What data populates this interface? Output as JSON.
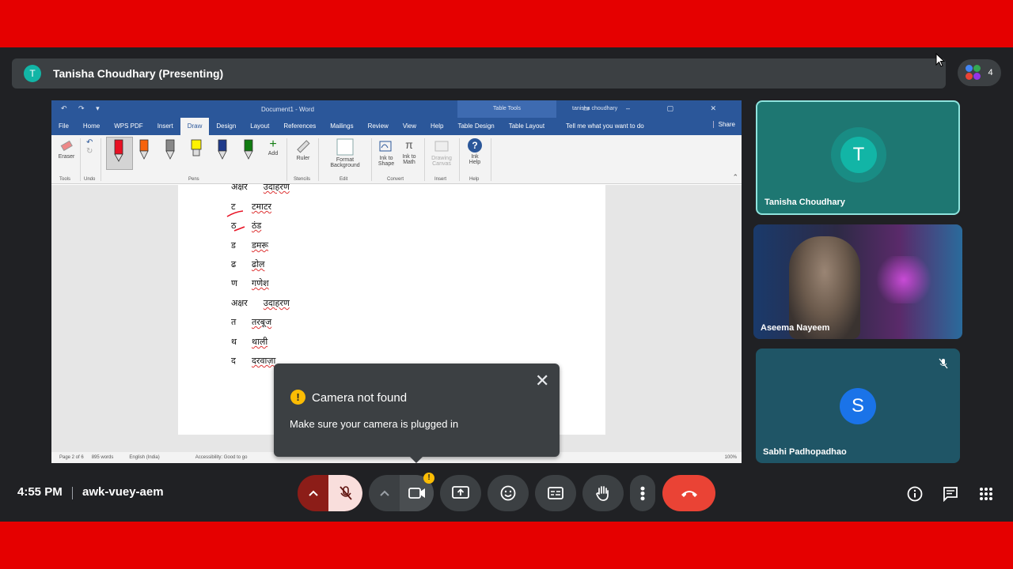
{
  "meeting": {
    "presenter_initial": "T",
    "presenter_banner": "Tanisha Choudhary (Presenting)",
    "participant_count": "4",
    "time": "4:55 PM",
    "meeting_code": "awk-vuey-aem"
  },
  "word": {
    "quick_access": "↶ ↷ ▾",
    "doc_title": "Document1 - Word",
    "table_tools": "Table Tools",
    "user": "tanisha choudhary",
    "window_controls": "▭ – ▢ ✕",
    "tabs": [
      "File",
      "Home",
      "WPS PDF",
      "Insert",
      "Draw",
      "Design",
      "Layout",
      "References",
      "Mailings",
      "Review",
      "View",
      "Help",
      "Table Design",
      "Table Layout"
    ],
    "tell_me": "Tell me what you want to do",
    "share": "Share",
    "ribbon": {
      "eraser": "Eraser",
      "add": "Add",
      "ruler": "Ruler",
      "format_background_1": "Format",
      "format_background_2": "Background",
      "ink_to_shape_1": "Ink to",
      "ink_to_shape_2": "Shape",
      "ink_to_math_1": "Ink to",
      "ink_to_math_2": "Math",
      "drawing_canvas_1": "Drawing",
      "drawing_canvas_2": "Canvas",
      "ink_help_1": "Ink",
      "ink_help_2": "Help",
      "groups": [
        "Tools",
        "Undo",
        "Pens",
        "Stencils",
        "Edit",
        "Convert",
        "Insert",
        "Help"
      ]
    },
    "rows": [
      {
        "letter": "अक्षर",
        "word": "उदाहरण"
      },
      {
        "letter": "ट",
        "word": "टमाटर"
      },
      {
        "letter": "ठ",
        "word": "ठंड"
      },
      {
        "letter": "ड",
        "word": "डमरू"
      },
      {
        "letter": "ढ",
        "word": "ढोल"
      },
      {
        "letter": "ण",
        "word": "गणेश"
      },
      {
        "letter": "अक्षर",
        "word": "उदाहरण"
      },
      {
        "letter": "त",
        "word": "तरबूज"
      },
      {
        "letter": "थ",
        "word": "थाली"
      },
      {
        "letter": "द",
        "word": "दरवाज़ा"
      }
    ],
    "status": {
      "page": "Page 2 of 6",
      "words": "895 words",
      "language": "English (India)",
      "accessibility": "Accessibility: Good to go",
      "zoom": "100%"
    }
  },
  "toast": {
    "title": "Camera not found",
    "message": "Make sure your camera is plugged in"
  },
  "tiles": [
    {
      "name": "Tanisha Choudhary",
      "initial": "T"
    },
    {
      "name": "Aseema Nayeem"
    },
    {
      "name": "Sabhi Padhopadhao",
      "initial": "S"
    }
  ],
  "colors": {
    "frame_red": "#e50000",
    "meet_bg": "#202124",
    "teal": "#12b5a6",
    "end_call": "#ea4335",
    "word_blue": "#2b579a"
  }
}
